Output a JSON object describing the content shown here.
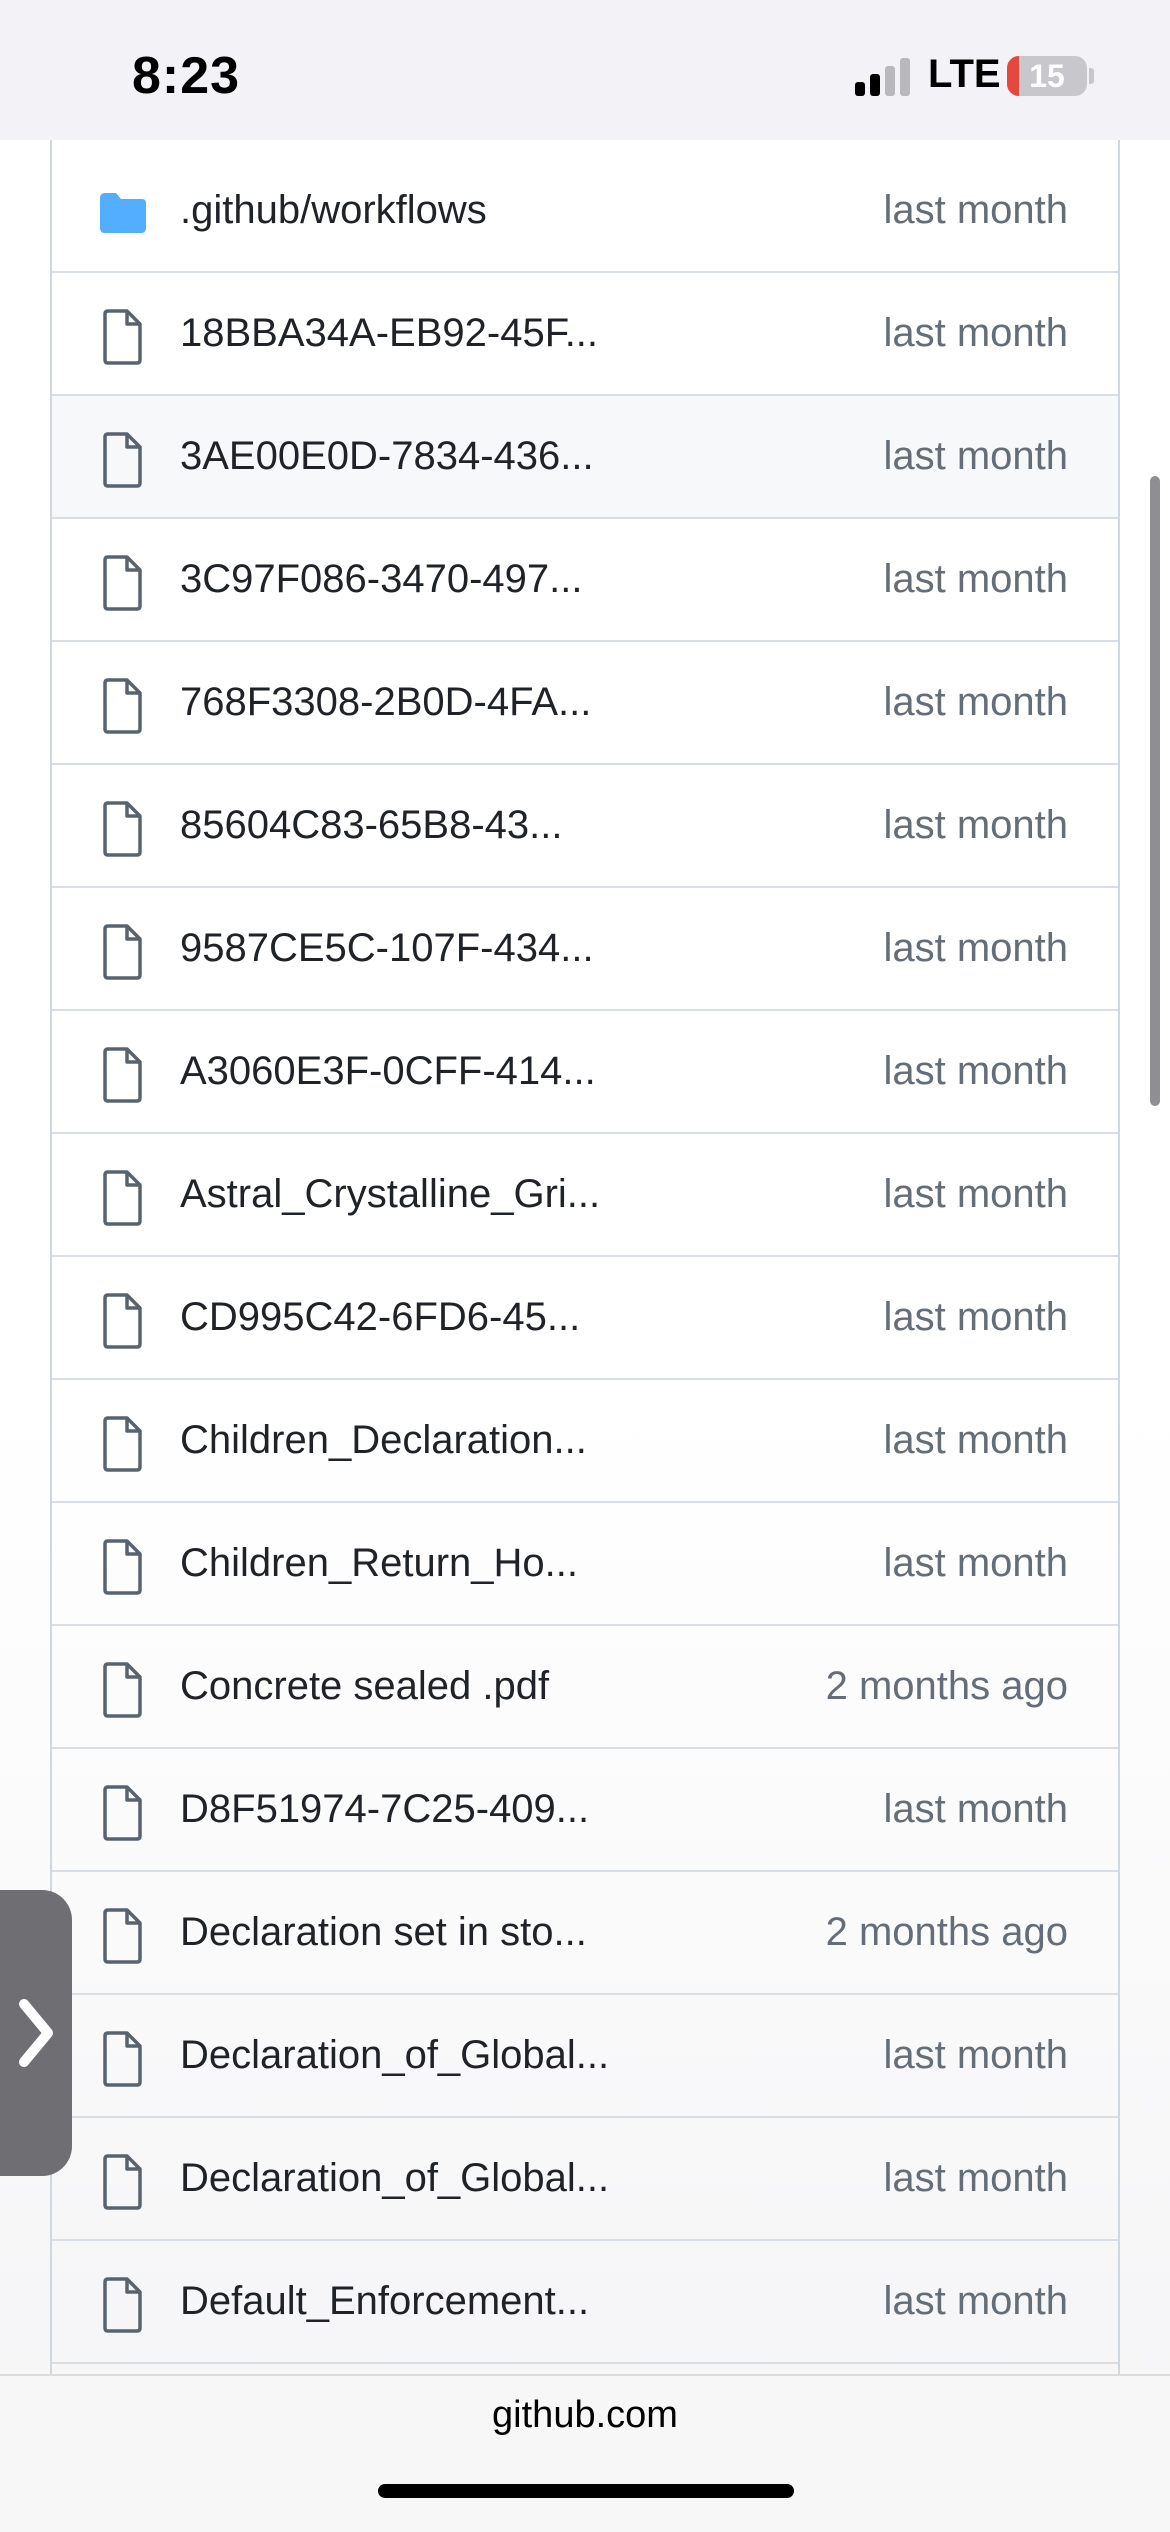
{
  "status_bar": {
    "time": "8:23",
    "network": "LTE",
    "battery_level": "15",
    "battery_fraction": 0.15,
    "signal_bars_active": 2,
    "signal_bars_total": 4
  },
  "file_list": {
    "folder_color": "#54aeff",
    "rows": [
      {
        "type": "folder",
        "icon": "folder-icon",
        "name": ".github/workflows",
        "time": "last month"
      },
      {
        "type": "file",
        "icon": "file-icon",
        "name": "18BBA34A-EB92-45F...",
        "time": "last month"
      },
      {
        "type": "file",
        "icon": "file-icon",
        "name": "3AE00E0D-7834-436...",
        "time": "last month",
        "highlighted": true
      },
      {
        "type": "file",
        "icon": "file-icon",
        "name": "3C97F086-3470-497...",
        "time": "last month"
      },
      {
        "type": "file",
        "icon": "file-icon",
        "name": "768F3308-2B0D-4FA...",
        "time": "last month"
      },
      {
        "type": "file",
        "icon": "file-icon",
        "name": "85604C83-65B8-43...",
        "time": "last month"
      },
      {
        "type": "file",
        "icon": "file-icon",
        "name": "9587CE5C-107F-434...",
        "time": "last month"
      },
      {
        "type": "file",
        "icon": "file-icon",
        "name": "A3060E3F-0CFF-414...",
        "time": "last month"
      },
      {
        "type": "file",
        "icon": "file-icon",
        "name": "Astral_Crystalline_Gri...",
        "time": "last month"
      },
      {
        "type": "file",
        "icon": "file-icon",
        "name": "CD995C42-6FD6-45...",
        "time": "last month"
      },
      {
        "type": "file",
        "icon": "file-icon",
        "name": "Children_Declaration...",
        "time": "last month"
      },
      {
        "type": "file",
        "icon": "file-icon",
        "name": "Children_Return_Ho...",
        "time": "last month"
      },
      {
        "type": "file",
        "icon": "file-icon",
        "name": "Concrete sealed .pdf",
        "time": "2 months ago"
      },
      {
        "type": "file",
        "icon": "file-icon",
        "name": "D8F51974-7C25-409...",
        "time": "last month"
      },
      {
        "type": "file",
        "icon": "file-icon",
        "name": "Declaration set in sto...",
        "time": "2 months ago"
      },
      {
        "type": "file",
        "icon": "file-icon",
        "name": "Declaration_of_Global...",
        "time": "last month"
      },
      {
        "type": "file",
        "icon": "file-icon",
        "name": "Declaration_of_Global...",
        "time": "last month"
      },
      {
        "type": "file",
        "icon": "file-icon",
        "name": "Default_Enforcement...",
        "time": "last month"
      }
    ]
  },
  "side_handle": {
    "icon": "chevron-right-icon"
  },
  "browser": {
    "url": "github.com"
  }
}
